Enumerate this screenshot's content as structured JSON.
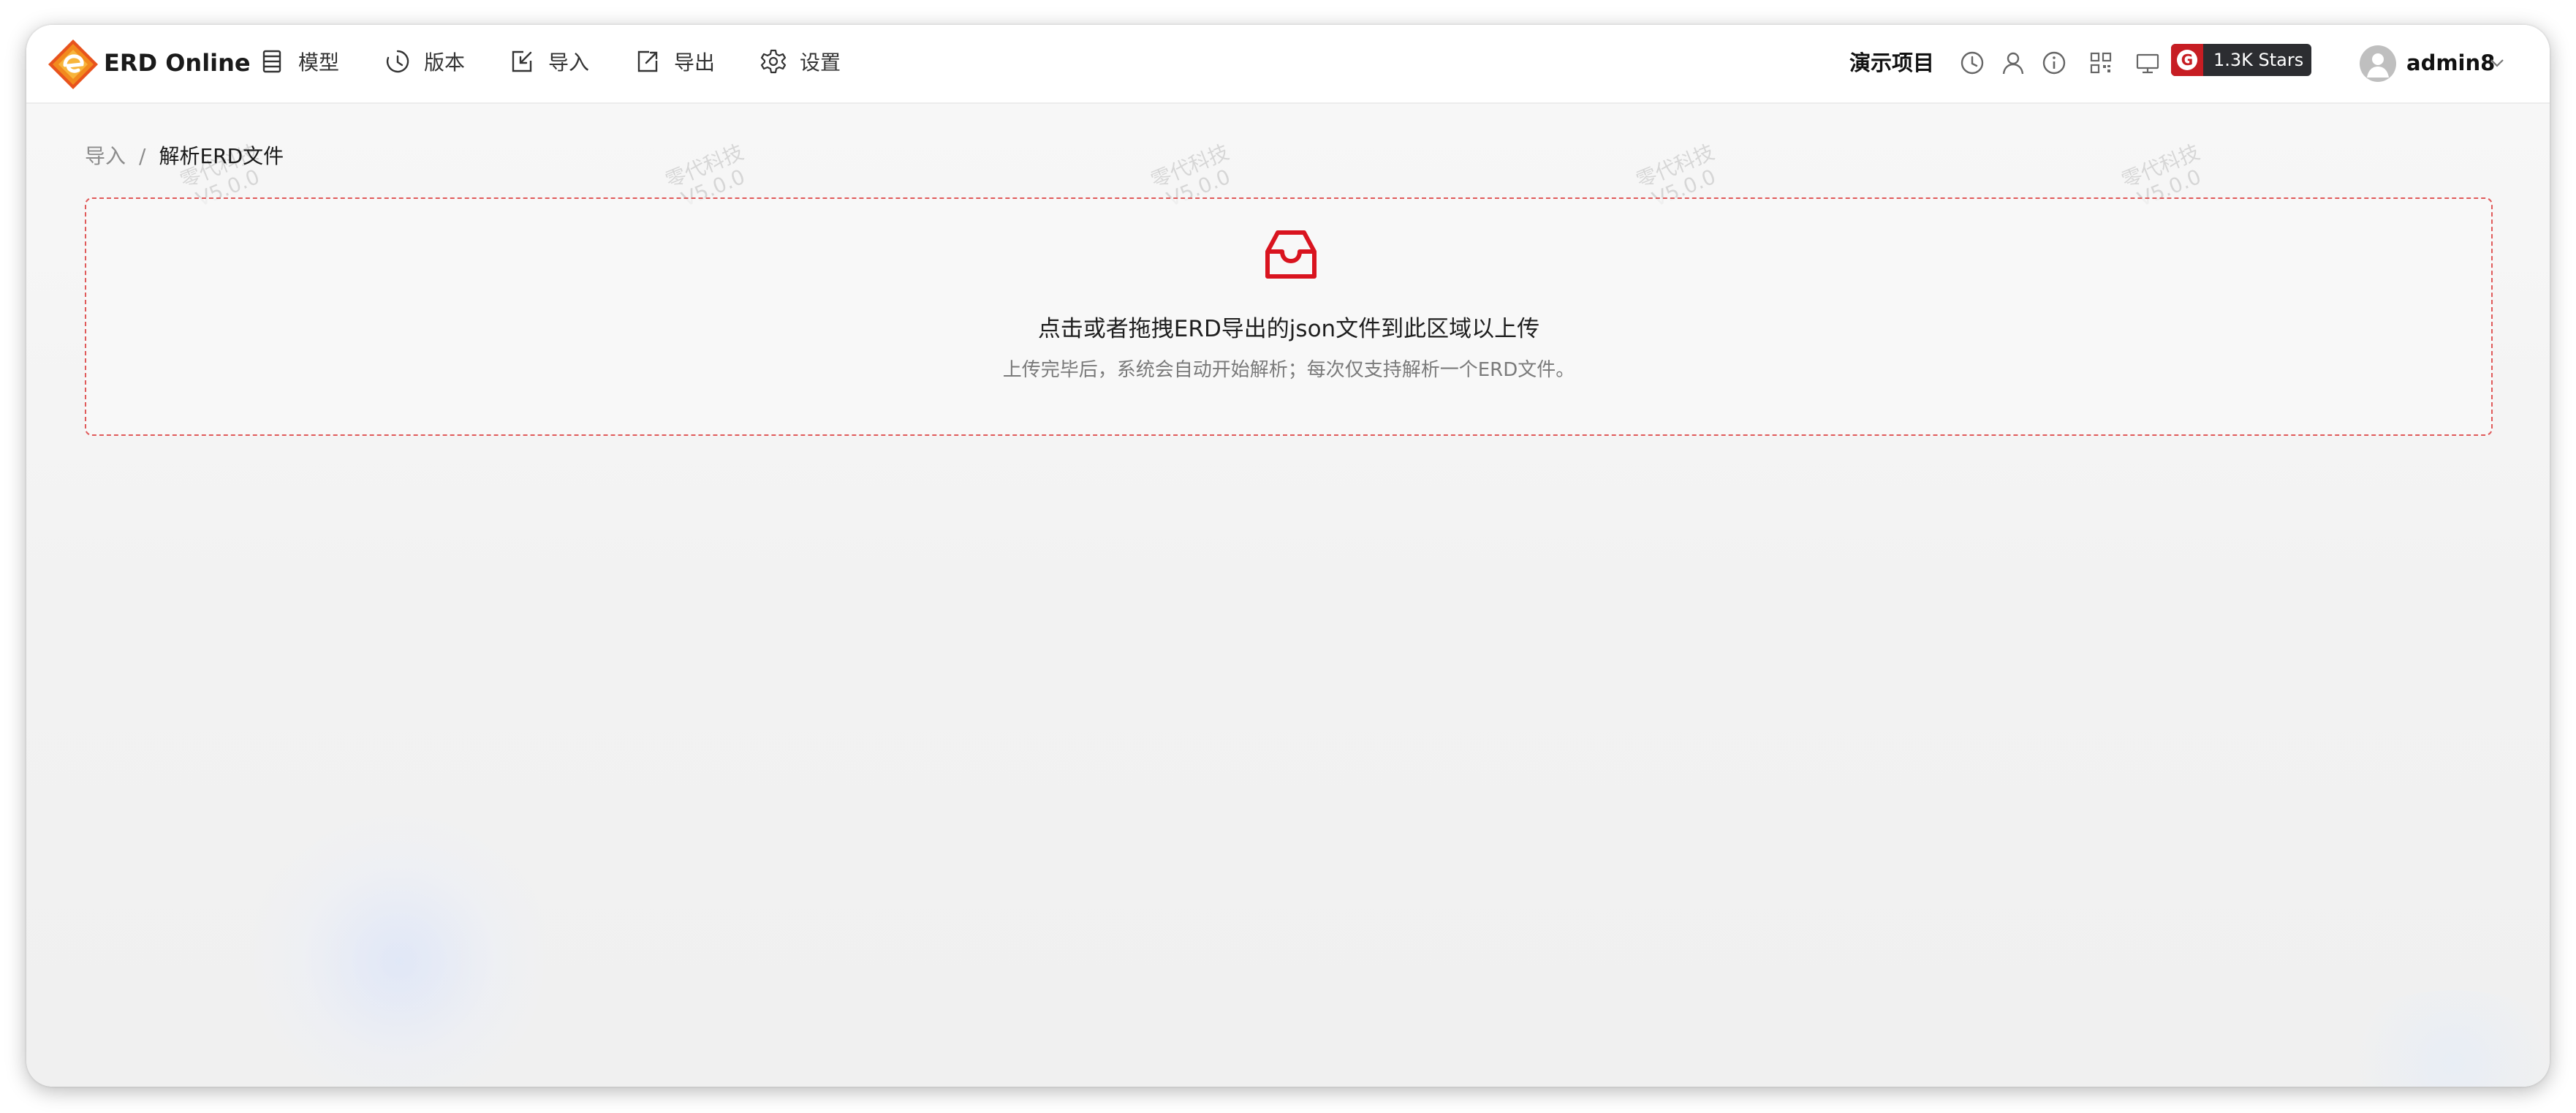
{
  "header": {
    "app_title": "ERD Online",
    "nav": [
      {
        "label": "模型",
        "icon": "model-icon"
      },
      {
        "label": "版本",
        "icon": "history-icon"
      },
      {
        "label": "导入",
        "icon": "import-icon"
      },
      {
        "label": "导出",
        "icon": "export-icon"
      },
      {
        "label": "设置",
        "icon": "gear-icon"
      }
    ],
    "project_name": "演示项目",
    "tool_icons": [
      "clock-icon",
      "user-icon",
      "info-icon",
      "qrcode-icon",
      "monitor-icon"
    ],
    "stars_badge": "1.3K Stars",
    "user_name": "admin8"
  },
  "breadcrumb": {
    "parent": "导入",
    "separator": "/",
    "current": "解析ERD文件"
  },
  "watermark": {
    "line1": "零代科技",
    "line2": "V5.0.0"
  },
  "upload": {
    "icon": "inbox-icon",
    "text": "点击或者拖拽ERD导出的json文件到此区域以上传",
    "hint": "上传完毕后，系统会自动开始解析；每次仅支持解析一个ERD文件。"
  },
  "colors": {
    "accent": "#d9141f",
    "upload_border": "#e05a5a",
    "badge_bg": "#2c2d31",
    "gitee_red": "#c71d23"
  }
}
